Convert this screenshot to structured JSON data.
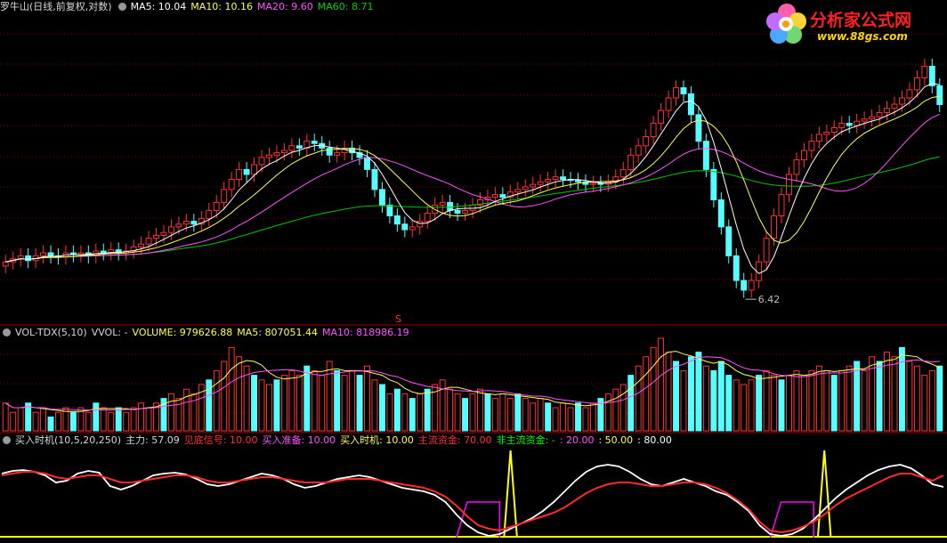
{
  "logo": {
    "title": "分析家公式网",
    "url": "www.88gs.com"
  },
  "panel1": {
    "title": "罗牛山(日线,前复权,对数)",
    "ma5": "MA5: 10.04",
    "ma10": "MA10: 10.16",
    "ma20": "MA20: 9.60",
    "ma60": "MA60: 8.71",
    "low_label": "6.42",
    "marker": "S"
  },
  "panel2": {
    "name": "VOL-TDX(5,10)",
    "vvol": "VVOL: -",
    "volume": "VOLUME: 979626.88",
    "ma5": "MA5: 807051.44",
    "ma10": "MA10: 818986.19"
  },
  "panel3": {
    "name": "买入时机(10,5,20,250)",
    "zhuli": "主力: 57.09",
    "jiandi": "见底信号: 10.00",
    "zhunbei": "买入准备: 10.00",
    "shiji": "买入时机: 10.00",
    "zhuliu": "主流资金: 70.00",
    "feizhuliu": "非主流资金: -",
    "l20": ": 20.00",
    "l50": ": 50.00",
    "l80": ": 80.00"
  },
  "colors": {
    "up": "#ff3232",
    "down": "#54ffff",
    "ma5": "#ffffff",
    "ma10": "#ffff54",
    "ma20": "#ff54ff",
    "ma60": "#00c800",
    "grid": "#800000",
    "zhuli": "#ffffff",
    "zhuliu": "#ff2a2a",
    "feizhuliu": "#00ff00",
    "signal": "#ffff00",
    "prep": "#ff00ff"
  },
  "chart_data": [
    {
      "type": "candlestick",
      "title": "罗牛山(日线,前复权,对数)",
      "low_marker": 6.42,
      "close": [
        6.9,
        6.95,
        7.0,
        6.92,
        7.0,
        7.05,
        7.0,
        6.98,
        7.05,
        7.02,
        7.05,
        7.0,
        7.08,
        7.05,
        7.1,
        7.05,
        7.08,
        7.15,
        7.2,
        7.3,
        7.35,
        7.4,
        7.5,
        7.55,
        7.6,
        7.55,
        7.65,
        7.8,
        7.95,
        8.2,
        8.4,
        8.6,
        8.5,
        8.7,
        8.85,
        8.9,
        8.95,
        9.0,
        9.1,
        9.05,
        9.2,
        9.15,
        9.05,
        8.9,
        8.95,
        9.05,
        8.95,
        8.85,
        8.6,
        8.2,
        7.9,
        7.7,
        7.55,
        7.45,
        7.5,
        7.6,
        7.75,
        7.9,
        7.95,
        7.8,
        7.75,
        7.8,
        7.9,
        8.0,
        8.05,
        8.1,
        8.05,
        8.15,
        8.2,
        8.25,
        8.3,
        8.35,
        8.4,
        8.45,
        8.4,
        8.38,
        8.35,
        8.3,
        8.32,
        8.3,
        8.35,
        8.45,
        8.6,
        8.9,
        9.1,
        9.3,
        9.6,
        9.9,
        10.2,
        10.45,
        10.3,
        9.8,
        9.2,
        8.6,
        8.0,
        7.5,
        7.0,
        6.6,
        6.45,
        6.6,
        6.9,
        7.3,
        7.7,
        8.1,
        8.5,
        8.8,
        9.0,
        9.2,
        9.35,
        9.4,
        9.5,
        9.6,
        9.55,
        9.65,
        9.7,
        9.75,
        9.85,
        9.95,
        10.05,
        10.2,
        10.4,
        10.7,
        11.0,
        10.5,
        10.04
      ],
      "ma5_last": 10.04,
      "ma10_last": 10.16,
      "ma20_last": 9.6,
      "ma60_last": 8.71
    },
    {
      "type": "bar",
      "title": "VOL-TDX(5,10)",
      "volume_last": 979626.88,
      "ma5_last": 807051.44,
      "ma10_last": 818986.19,
      "values": [
        6,
        4,
        5,
        6,
        4,
        5,
        3,
        4,
        5,
        4,
        5,
        4,
        6,
        5,
        4,
        5,
        4,
        5,
        6,
        5,
        6,
        7,
        8,
        7,
        9,
        8,
        10,
        11,
        13,
        15,
        18,
        16,
        14,
        12,
        11,
        10,
        11,
        12,
        13,
        12,
        14,
        13,
        12,
        15,
        13,
        12,
        13,
        12,
        14,
        11,
        10,
        8,
        9,
        8,
        7,
        8,
        9,
        10,
        11,
        9,
        8,
        7,
        8,
        9,
        8,
        7,
        8,
        7,
        8,
        7,
        6,
        7,
        6,
        5,
        6,
        5,
        6,
        5,
        6,
        7,
        8,
        9,
        10,
        12,
        14,
        16,
        18,
        20,
        17,
        15,
        13,
        16,
        17,
        14,
        13,
        15,
        12,
        11,
        10,
        11,
        12,
        13,
        12,
        11,
        12,
        13,
        12,
        13,
        14,
        13,
        12,
        13,
        14,
        15,
        13,
        16,
        15,
        17,
        16,
        18,
        15,
        14,
        12,
        13,
        14
      ],
      "down_idx": [
        3,
        6,
        9,
        12,
        15,
        21,
        27,
        33,
        36,
        40,
        44,
        47,
        50,
        52,
        54,
        56,
        61,
        64,
        68,
        72,
        76,
        79,
        83,
        89,
        91,
        92,
        94,
        95,
        96,
        100,
        103,
        110,
        113,
        116,
        119,
        124
      ]
    },
    {
      "type": "line",
      "title": "买入时机(10,5,20,250)",
      "series": [
        {
          "name": "主力",
          "values": [
            72,
            75,
            76,
            74,
            70,
            62,
            64,
            72,
            75,
            73,
            58,
            54,
            58,
            64,
            70,
            72,
            73,
            71,
            66,
            60,
            58,
            60,
            64,
            68,
            72,
            70,
            66,
            60,
            56,
            58,
            62,
            66,
            68,
            70,
            68,
            64,
            60,
            56,
            54,
            52,
            48,
            40,
            26,
            14,
            6,
            2,
            4,
            10,
            16,
            22,
            30,
            40,
            52,
            64,
            74,
            80,
            82,
            80,
            74,
            66,
            60,
            58,
            62,
            66,
            62,
            58,
            52,
            48,
            40,
            30,
            14,
            4,
            2,
            4,
            10,
            20,
            32,
            44,
            54,
            62,
            70,
            76,
            80,
            82,
            78,
            70,
            60,
            57
          ]
        },
        {
          "name": "主流资金",
          "values": [
            70,
            72,
            74,
            74,
            72,
            68,
            66,
            68,
            70,
            70,
            66,
            62,
            62,
            64,
            66,
            68,
            70,
            70,
            68,
            64,
            62,
            62,
            64,
            66,
            68,
            68,
            66,
            64,
            62,
            62,
            62,
            64,
            66,
            66,
            66,
            64,
            62,
            60,
            58,
            56,
            52,
            46,
            36,
            24,
            14,
            10,
            8,
            12,
            16,
            20,
            24,
            28,
            34,
            42,
            50,
            56,
            60,
            62,
            62,
            60,
            58,
            58,
            60,
            62,
            62,
            60,
            56,
            50,
            42,
            32,
            18,
            8,
            6,
            8,
            12,
            18,
            26,
            36,
            44,
            50,
            56,
            62,
            68,
            72,
            72,
            68,
            64,
            70
          ]
        }
      ],
      "ylim": [
        0,
        100
      ],
      "levels": [
        20,
        50,
        80
      ]
    }
  ]
}
